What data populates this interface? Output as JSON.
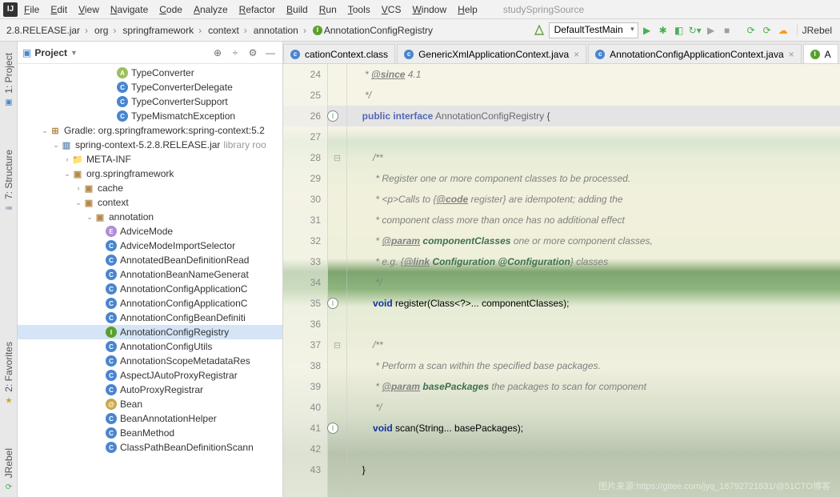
{
  "menubar": {
    "items": [
      "File",
      "Edit",
      "View",
      "Navigate",
      "Code",
      "Analyze",
      "Refactor",
      "Build",
      "Run",
      "Tools",
      "VCS",
      "Window",
      "Help"
    ],
    "project": "studySpringSource"
  },
  "breadcrumbs": [
    "2.8.RELEASE.jar",
    "org",
    "springframework",
    "context",
    "annotation",
    "AnnotationConfigRegistry"
  ],
  "runConfig": "DefaultTestMain",
  "jrebel": "JRebel",
  "projectPane": {
    "title": "Project"
  },
  "leftTabs": {
    "project": "1: Project",
    "structure": "7: Structure",
    "favorites": "2: Favorites",
    "jrebel": "JRebel"
  },
  "tree": [
    {
      "d": 8,
      "ic": "a",
      "lbl": "TypeConverter"
    },
    {
      "d": 8,
      "ic": "c",
      "lbl": "TypeConverterDelegate"
    },
    {
      "d": 8,
      "ic": "c",
      "lbl": "TypeConverterSupport"
    },
    {
      "d": 8,
      "ic": "c",
      "lbl": "TypeMismatchException"
    },
    {
      "d": 2,
      "tw": "v",
      "ic": "lib",
      "lbl": "Gradle: org.springframework:spring-context:5.2"
    },
    {
      "d": 3,
      "tw": "v",
      "ic": "jar",
      "lbl": "spring-context-5.2.8.RELEASE.jar",
      "faint": "library roo"
    },
    {
      "d": 4,
      "tw": ">",
      "ic": "fld",
      "lbl": "META-INF"
    },
    {
      "d": 4,
      "tw": "v",
      "ic": "pkg",
      "lbl": "org.springframework"
    },
    {
      "d": 5,
      "tw": ">",
      "ic": "pkg",
      "lbl": "cache"
    },
    {
      "d": 5,
      "tw": "v",
      "ic": "pkg",
      "lbl": "context"
    },
    {
      "d": 6,
      "tw": "v",
      "ic": "pkg",
      "lbl": "annotation"
    },
    {
      "d": 7,
      "ic": "e",
      "lbl": "AdviceMode"
    },
    {
      "d": 7,
      "ic": "c",
      "lbl": "AdviceModeImportSelector"
    },
    {
      "d": 7,
      "ic": "c",
      "lbl": "AnnotatedBeanDefinitionRead"
    },
    {
      "d": 7,
      "ic": "c",
      "lbl": "AnnotationBeanNameGenerat"
    },
    {
      "d": 7,
      "ic": "c",
      "lbl": "AnnotationConfigApplicationC"
    },
    {
      "d": 7,
      "ic": "c",
      "lbl": "AnnotationConfigApplicationC"
    },
    {
      "d": 7,
      "ic": "c",
      "lbl": "AnnotationConfigBeanDefiniti"
    },
    {
      "d": 7,
      "ic": "i",
      "lbl": "AnnotationConfigRegistry",
      "sel": true
    },
    {
      "d": 7,
      "ic": "c",
      "lbl": "AnnotationConfigUtils"
    },
    {
      "d": 7,
      "ic": "c",
      "lbl": "AnnotationScopeMetadataRes"
    },
    {
      "d": 7,
      "ic": "c",
      "lbl": "AspectJAutoProxyRegistrar"
    },
    {
      "d": 7,
      "ic": "c",
      "lbl": "AutoProxyRegistrar"
    },
    {
      "d": 7,
      "ic": "at",
      "lbl": "Bean"
    },
    {
      "d": 7,
      "ic": "c",
      "lbl": "BeanAnnotationHelper"
    },
    {
      "d": 7,
      "ic": "c",
      "lbl": "BeanMethod"
    },
    {
      "d": 7,
      "ic": "c",
      "lbl": "ClassPathBeanDefinitionScann"
    }
  ],
  "tabs": [
    {
      "ic": "c",
      "bg": "#4a86cf",
      "lbl": "cationContext.class",
      "active": false,
      "trunc": true
    },
    {
      "ic": "c",
      "bg": "#4a86cf",
      "lbl": "GenericXmlApplicationContext.java",
      "active": false
    },
    {
      "ic": "c",
      "bg": "#4a86cf",
      "lbl": "AnnotationConfigApplicationContext.java",
      "active": false
    },
    {
      "ic": "I",
      "bg": "#5aa02c",
      "lbl": "A",
      "active": true,
      "trunc": true
    }
  ],
  "code": {
    "start": 24,
    "lines": [
      {
        "n": 24,
        "html": "   <span class='doc'>* <span class='tag'>@since</span> 4.1</span>"
      },
      {
        "n": 25,
        "html": "   <span class='doc'>*/</span>"
      },
      {
        "n": 26,
        "mark": "I",
        "html": "  <span class='kw'>public interface</span> <span class='name'>AnnotationConfigRegistry</span> {",
        "hl": true
      },
      {
        "n": 27,
        "html": ""
      },
      {
        "n": 28,
        "g2": "⊟",
        "html": "      <span class='doc'>/**</span>"
      },
      {
        "n": 29,
        "html": "       <span class='doc'>* Register one or more component classes to be processed.</span>"
      },
      {
        "n": 30,
        "html": "       <span class='doc'>* &lt;p&gt;Calls to {<span class='tag'>@code</span> register} are idempotent; adding the</span>"
      },
      {
        "n": 31,
        "html": "       <span class='doc'>* component class more than once has no additional effect</span>"
      },
      {
        "n": 32,
        "html": "       <span class='doc'>* <span class='tag'>@param</span> <span class='docparam'>componentClasses</span> one or more component classes,</span>"
      },
      {
        "n": 33,
        "html": "       <span class='doc'>* e.g. {<span class='tag'>@link</span> <span class='docparam'>Configuration @Configuration</span>} classes</span>"
      },
      {
        "n": 34,
        "html": "       <span class='doc'>*/</span>"
      },
      {
        "n": 35,
        "mark": "I",
        "html": "      <span class='kw'>void</span> register(Class&lt;?&gt;... componentClasses);"
      },
      {
        "n": 36,
        "html": ""
      },
      {
        "n": 37,
        "g2": "⊟",
        "html": "      <span class='doc'>/**</span>"
      },
      {
        "n": 38,
        "html": "       <span class='doc'>* Perform a scan within the specified base packages.</span>"
      },
      {
        "n": 39,
        "html": "       <span class='doc'>* <span class='tag'>@param</span> <span class='docparam'>basePackages</span> the packages to scan for component</span>"
      },
      {
        "n": 40,
        "html": "       <span class='doc'>*/</span>"
      },
      {
        "n": 41,
        "mark": "I",
        "html": "      <span class='kw'>void</span> scan(String... basePackages);"
      },
      {
        "n": 42,
        "html": ""
      },
      {
        "n": 43,
        "html": "  }"
      }
    ]
  },
  "watermark": "图片来源:https://gitee.com/jyq_18792721831/@51CTO博客"
}
